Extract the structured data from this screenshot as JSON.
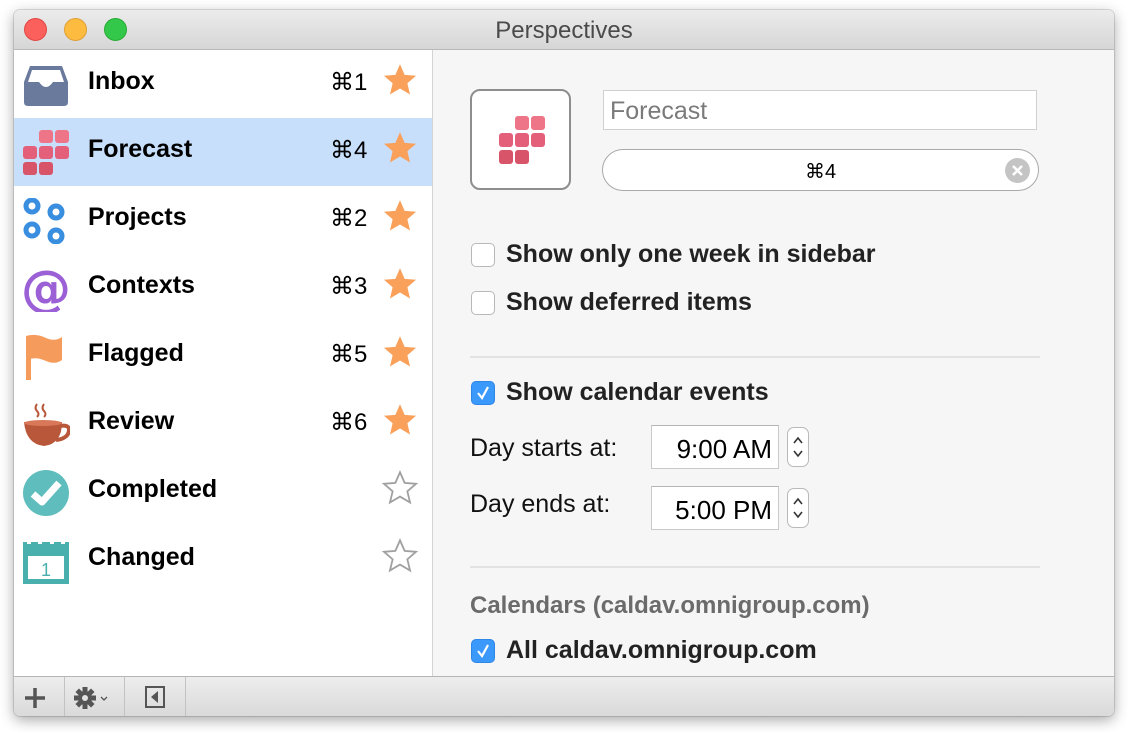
{
  "window": {
    "title": "Perspectives"
  },
  "sidebar": {
    "items": [
      {
        "label": "Inbox",
        "shortcut": "⌘1",
        "favorite": true,
        "icon": "inbox-icon",
        "selected": false
      },
      {
        "label": "Forecast",
        "shortcut": "⌘4",
        "favorite": true,
        "icon": "forecast-icon",
        "selected": true
      },
      {
        "label": "Projects",
        "shortcut": "⌘2",
        "favorite": true,
        "icon": "projects-icon",
        "selected": false
      },
      {
        "label": "Contexts",
        "shortcut": "⌘3",
        "favorite": true,
        "icon": "contexts-icon",
        "selected": false
      },
      {
        "label": "Flagged",
        "shortcut": "⌘5",
        "favorite": true,
        "icon": "flag-icon",
        "selected": false
      },
      {
        "label": "Review",
        "shortcut": "⌘6",
        "favorite": true,
        "icon": "coffee-cup-icon",
        "selected": false
      },
      {
        "label": "Completed",
        "shortcut": "",
        "favorite": false,
        "icon": "checkmark-circle-icon",
        "selected": false
      },
      {
        "label": "Changed",
        "shortcut": "",
        "favorite": false,
        "icon": "calendar-icon",
        "selected": false
      }
    ]
  },
  "detail": {
    "name_value": "Forecast",
    "shortcut_value": "⌘4",
    "options": {
      "one_week": {
        "label": "Show only one week in sidebar",
        "checked": false
      },
      "deferred": {
        "label": "Show deferred items",
        "checked": false
      },
      "calendar_events": {
        "label": "Show calendar events",
        "checked": true
      }
    },
    "day_start": {
      "label": "Day starts at:",
      "value": "9:00 AM"
    },
    "day_end": {
      "label": "Day ends at:",
      "value": "5:00 PM"
    },
    "calendars": {
      "heading": "Calendars (caldav.omnigroup.com)",
      "all": {
        "label": "All caldav.omnigroup.com",
        "checked": true
      }
    }
  },
  "colors": {
    "selection": "#c8dffb",
    "star_filled": "#f9a05b",
    "star_empty": "#a0a0a0",
    "checkbox_on": "#3b99fc",
    "forecast": "#e4607a",
    "inbox": "#6a7a9c",
    "projects": "#3a8ee0",
    "contexts": "#9b5fd6",
    "flagged": "#f59b5b",
    "review": "#b9573a",
    "completed": "#5fbdbd",
    "changed": "#4ab0ad"
  }
}
